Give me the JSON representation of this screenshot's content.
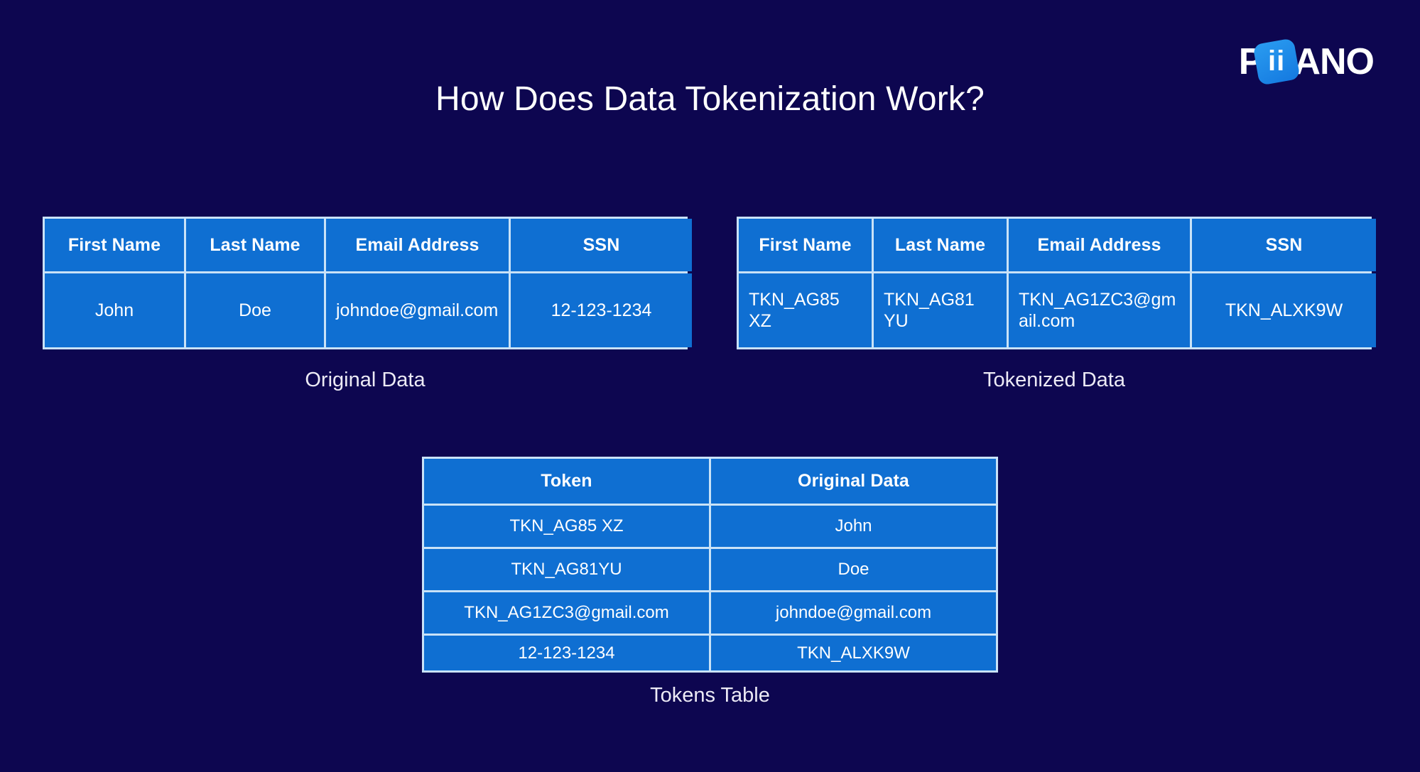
{
  "slide": {
    "title": "How Does Data Tokenization Work?",
    "background_color": "#0d0650",
    "cell_color": "#0f6fd2",
    "border_color": "#c9e2f7"
  },
  "logo": {
    "lead": "P",
    "tile": "ii",
    "trail": "ANO"
  },
  "original_table": {
    "caption": "Original Data",
    "headers": [
      "First Name",
      "Last Name",
      "Email Address",
      "SSN"
    ],
    "rows": [
      [
        "John",
        "Doe",
        "johndoe@gmail.com",
        "12-123-1234"
      ]
    ]
  },
  "tokenized_table": {
    "caption": "Tokenized Data",
    "headers": [
      "First Name",
      "Last Name",
      "Email Address",
      "SSN"
    ],
    "rows": [
      [
        "TKN_AG85 XZ",
        "TKN_AG81 YU",
        "TKN_AG1ZC3@gmail.com",
        "TKN_ALXK9W"
      ]
    ]
  },
  "tokens_table": {
    "caption": "Tokens Table",
    "headers": [
      "Token",
      "Original Data"
    ],
    "rows": [
      [
        "TKN_AG85 XZ",
        "John"
      ],
      [
        "TKN_AG81YU",
        "Doe"
      ],
      [
        "TKN_AG1ZC3@gmail.com",
        "johndoe@gmail.com"
      ],
      [
        "12-123-1234",
        "TKN_ALXK9W"
      ]
    ]
  }
}
